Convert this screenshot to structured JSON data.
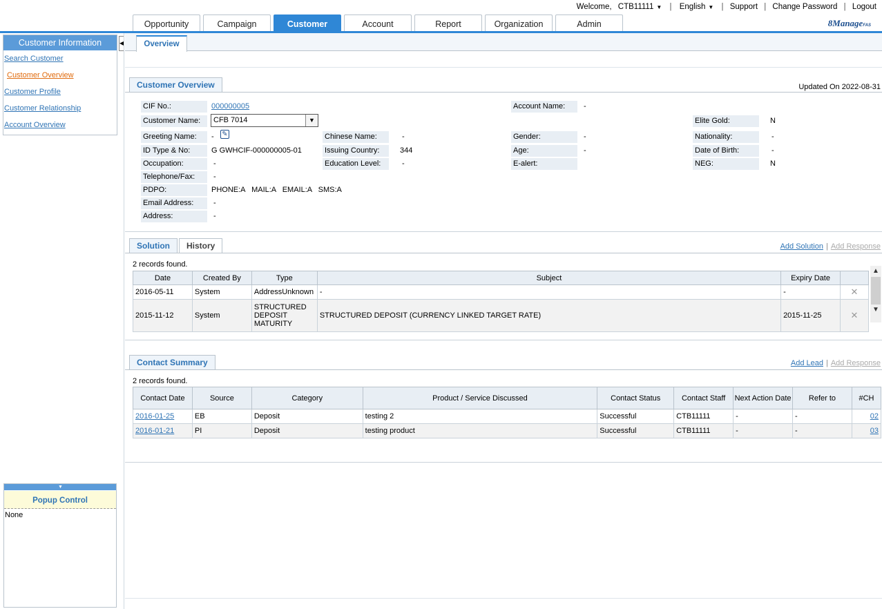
{
  "header": {
    "welcome": "Welcome,",
    "user": "CTB11111",
    "language": "English",
    "support": "Support",
    "change_password": "Change Password",
    "logout": "Logout",
    "logo_main": "8Manage",
    "logo_sub": "FAS",
    "tabs": [
      "Opportunity",
      "Campaign",
      "Customer",
      "Account",
      "Report",
      "Organization",
      "Admin"
    ],
    "active_tab": "Customer"
  },
  "sidebar": {
    "title": "Customer Information",
    "items": [
      "Search Customer",
      "Customer Overview",
      "Customer Profile",
      "Customer Relationship",
      "Account Overview"
    ],
    "active_item": "Customer Overview"
  },
  "popup": {
    "title": "Popup Control",
    "content": "None"
  },
  "subtab": "Overview",
  "overview": {
    "section_title": "Customer Overview",
    "updated_on": "Updated On 2022-08-31",
    "cif_label": "CIF No.:",
    "cif_value": "000000005",
    "name_label": "Customer Name:",
    "name_value": "CFB 7014",
    "account_name_label": "Account Name:",
    "account_name_value": "-",
    "elite_label": "Elite Gold:",
    "elite_value": "N",
    "greeting_label": "Greeting Name:",
    "greeting_value": "-",
    "chinese_label": "Chinese Name:",
    "chinese_value": "-",
    "gender_label": "Gender:",
    "gender_value": "-",
    "nationality_label": "Nationality:",
    "nationality_value": "-",
    "idtype_label": "ID Type & No:",
    "idtype_value": "G GWHCIF-000000005-01",
    "issuing_label": "Issuing Country:",
    "issuing_value": "344",
    "age_label": "Age:",
    "age_value": "-",
    "dob_label": "Date of Birth:",
    "dob_value": "-",
    "occupation_label": "Occupation:",
    "occupation_value": "-",
    "education_label": "Education Level:",
    "education_value": "-",
    "ealert_label": "E-alert:",
    "neg_label": "NEG:",
    "neg_value": "N",
    "tel_label": "Telephone/Fax:",
    "tel_value": "-",
    "pdpo_label": "PDPO:",
    "pdpo_value": "PHONE:A   MAIL:A   EMAIL:A   SMS:A",
    "email_label": "Email Address:",
    "email_value": "-",
    "address_label": "Address:",
    "address_value": "-"
  },
  "solution": {
    "tab_solution": "Solution",
    "tab_history": "History",
    "add_solution": "Add Solution",
    "add_response": "Add Response",
    "count": "2 records found.",
    "columns": [
      "Date",
      "Created By",
      "Type",
      "Subject",
      "Expiry Date",
      ""
    ],
    "rows": [
      {
        "date": "2016-05-11",
        "created_by": "System",
        "type": "AddressUnknown",
        "subject": "-",
        "expiry": "-"
      },
      {
        "date": "2015-11-12",
        "created_by": "System",
        "type": "STRUCTURED DEPOSIT MATURITY",
        "subject": "STRUCTURED DEPOSIT (CURRENCY LINKED TARGET RATE)",
        "expiry": "2015-11-25"
      }
    ]
  },
  "contact": {
    "section_title": "Contact Summary",
    "add_lead": "Add Lead",
    "add_response": "Add Response",
    "count": "2 records found.",
    "columns": [
      "Contact Date",
      "Source",
      "Category",
      "Product / Service Discussed",
      "Contact Status",
      "Contact Staff",
      "Next Action Date",
      "Refer to",
      "#CH"
    ],
    "rows": [
      {
        "date": "2016-01-25",
        "source": "EB",
        "category": "Deposit",
        "product": "testing 2",
        "status": "Successful",
        "staff": "CTB11111",
        "next": "-",
        "refer": "-",
        "ch": "02"
      },
      {
        "date": "2016-01-21",
        "source": "PI",
        "category": "Deposit",
        "product": "testing product",
        "status": "Successful",
        "staff": "CTB11111",
        "next": "-",
        "refer": "-",
        "ch": "03"
      }
    ]
  }
}
